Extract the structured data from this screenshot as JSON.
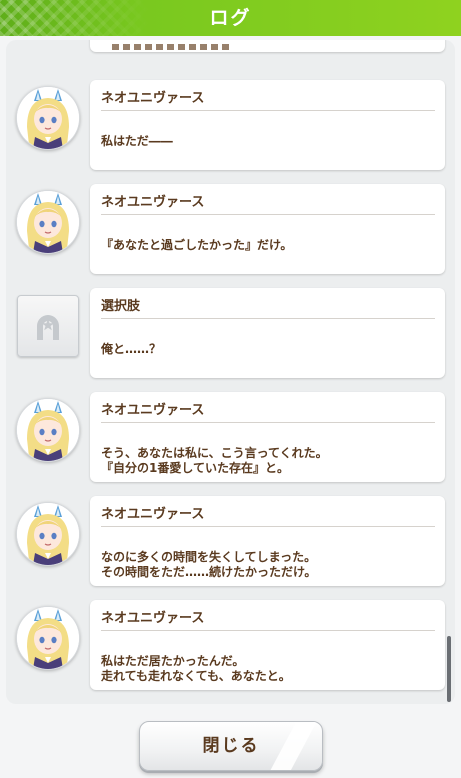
{
  "header": {
    "title": "ログ"
  },
  "entries": [
    {
      "speaker": "ネオユニヴァース",
      "avatar": "character",
      "lines": [
        "私はただ――"
      ]
    },
    {
      "speaker": "ネオユニヴァース",
      "avatar": "character",
      "lines": [
        "『あなたと過ごしたかった』だけ。"
      ]
    },
    {
      "speaker": "選択肢",
      "avatar": "choice",
      "lines": [
        "俺と……？"
      ]
    },
    {
      "speaker": "ネオユニヴァース",
      "avatar": "character",
      "lines": [
        "そう、あなたは私に、こう言ってくれた。",
        "『自分の1番愛していた存在』と。"
      ]
    },
    {
      "speaker": "ネオユニヴァース",
      "avatar": "character",
      "lines": [
        "なのに多くの時間を失くしてしまった。",
        "その時間をただ……続けたかっただけ。"
      ]
    },
    {
      "speaker": "ネオユニヴァース",
      "avatar": "character",
      "lines": [
        "私はただ居たかったんだ。",
        "走れても走れなくても、あなたと。"
      ]
    }
  ],
  "footer": {
    "close_label": "閉じる"
  },
  "colors": {
    "header_green": "#79c81f",
    "text_brown": "#5a3a1f"
  },
  "icons": {
    "choice_avatar": "horseshoe-star-icon",
    "character_avatar": "character-portrait"
  }
}
